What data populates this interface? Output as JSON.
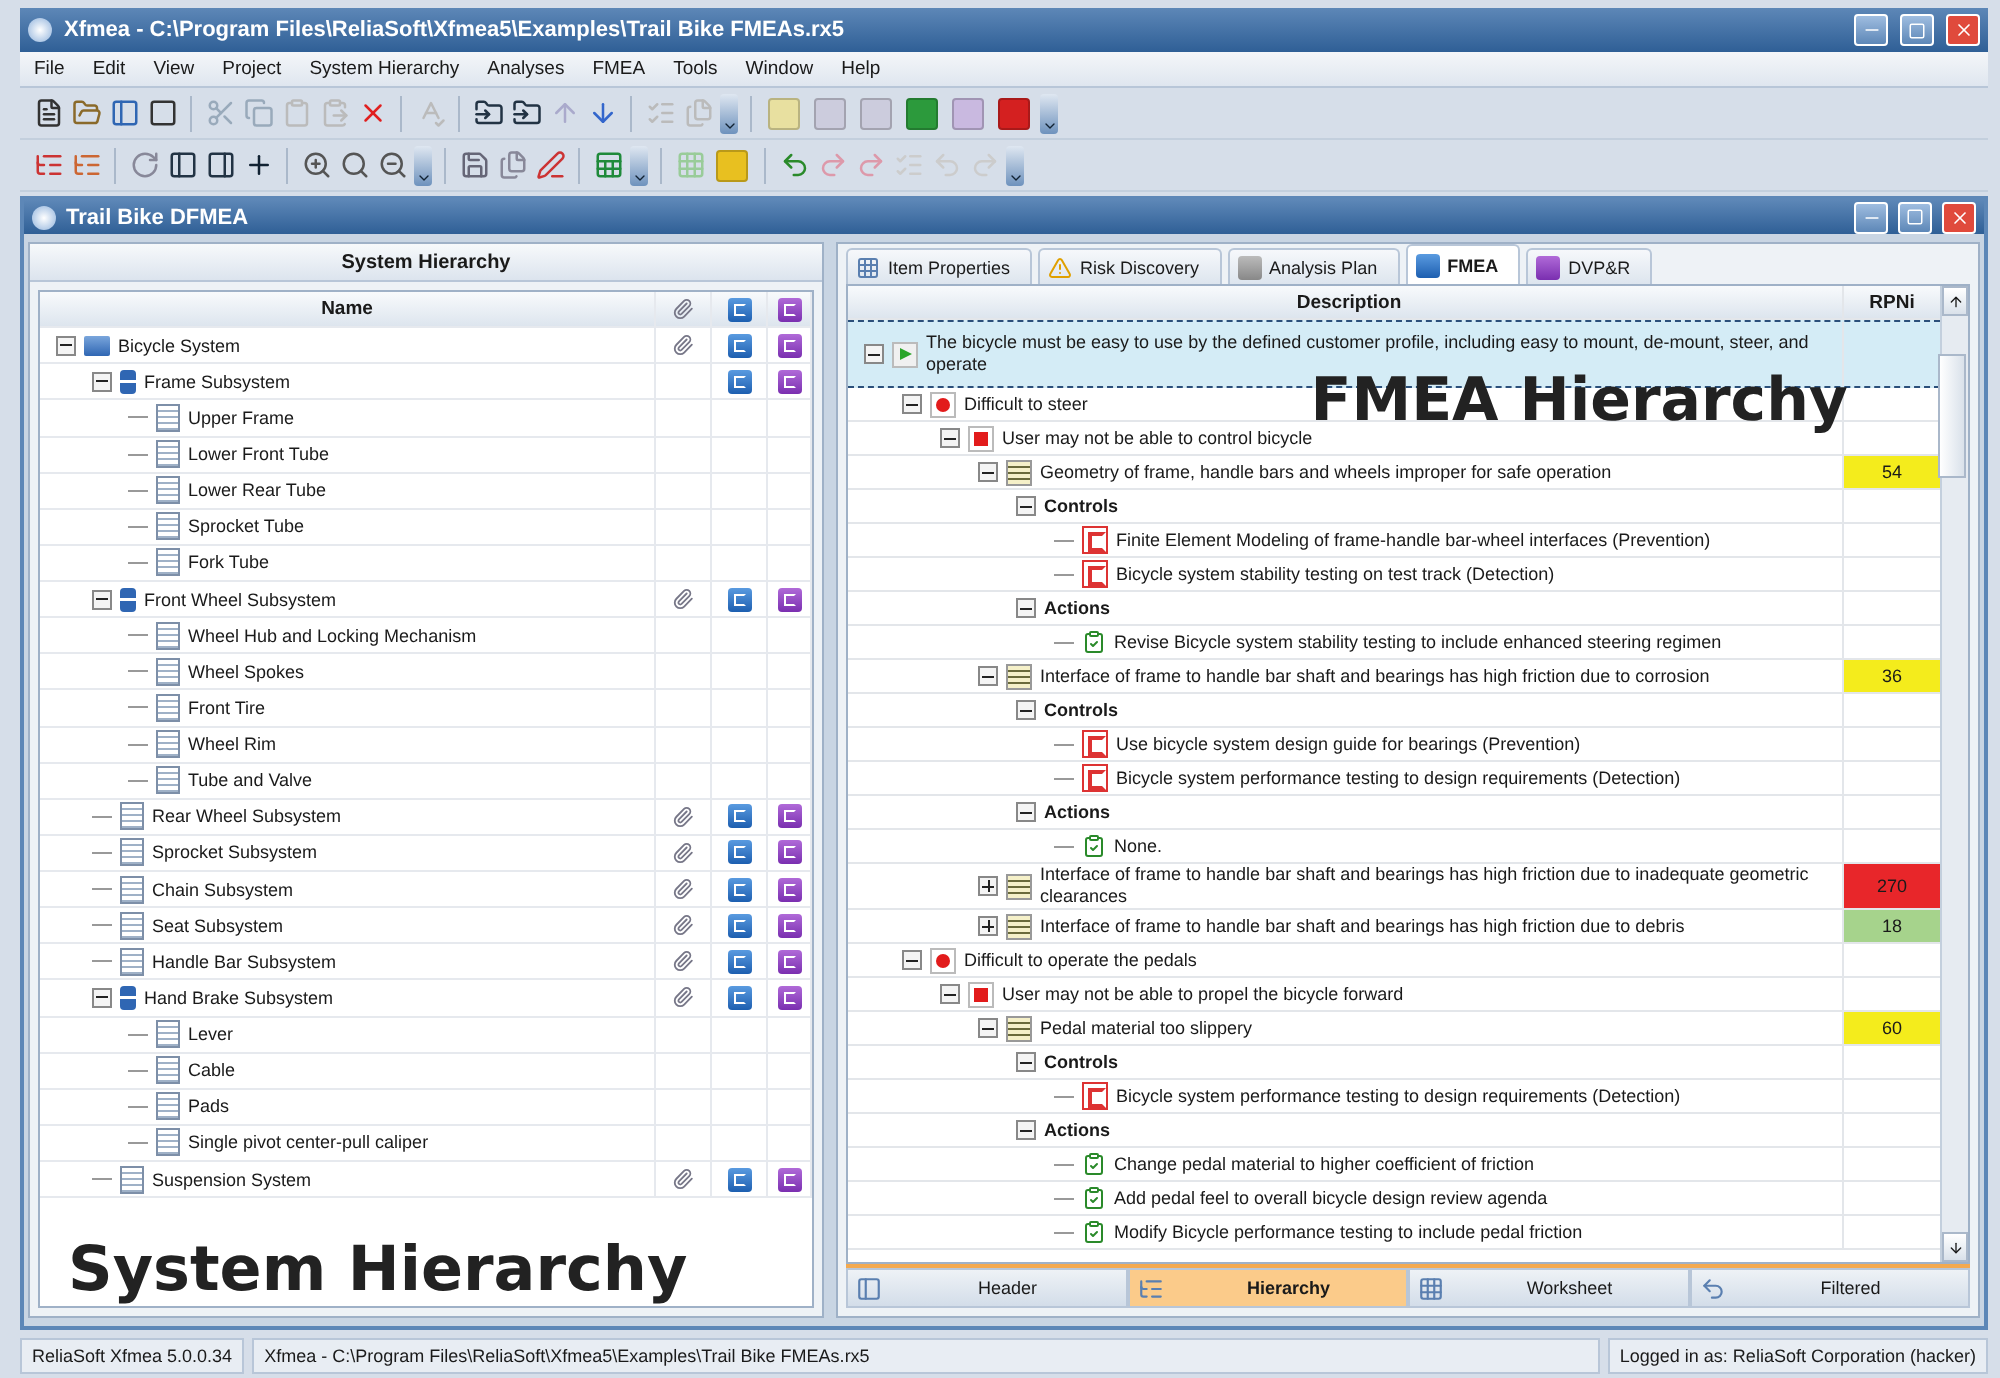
{
  "window": {
    "title": "Xfmea - C:\\Program Files\\ReliaSoft\\Xfmea5\\Examples\\Trail Bike FMEAs.rx5"
  },
  "menu": [
    "File",
    "Edit",
    "View",
    "Project",
    "System Hierarchy",
    "Analyses",
    "FMEA",
    "Tools",
    "Window",
    "Help"
  ],
  "document_window": {
    "title": "Trail Bike DFMEA"
  },
  "system_hierarchy": {
    "title": "System Hierarchy",
    "name_column": "Name",
    "caption": "System Hierarchy",
    "tree": [
      {
        "name": "Bicycle System",
        "kind": "system",
        "attachment": true,
        "fmea": true,
        "dvp": true,
        "expanded": true,
        "children": [
          {
            "name": "Frame Subsystem",
            "kind": "subsystem",
            "attachment": false,
            "fmea": true,
            "dvp": true,
            "expanded": true,
            "children": [
              {
                "name": "Upper Frame",
                "kind": "item",
                "attachment": false,
                "fmea": false,
                "dvp": false
              },
              {
                "name": "Lower Front Tube",
                "kind": "item",
                "attachment": false,
                "fmea": false,
                "dvp": false
              },
              {
                "name": "Lower Rear Tube",
                "kind": "item",
                "attachment": false,
                "fmea": false,
                "dvp": false
              },
              {
                "name": "Sprocket Tube",
                "kind": "item",
                "attachment": false,
                "fmea": false,
                "dvp": false
              },
              {
                "name": "Fork Tube",
                "kind": "item",
                "attachment": false,
                "fmea": false,
                "dvp": false
              }
            ]
          },
          {
            "name": "Front Wheel Subsystem",
            "kind": "subsystem",
            "attachment": true,
            "fmea": true,
            "dvp": true,
            "expanded": true,
            "children": [
              {
                "name": "Wheel Hub and Locking Mechanism",
                "kind": "item",
                "attachment": false,
                "fmea": false,
                "dvp": false
              },
              {
                "name": "Wheel Spokes",
                "kind": "item",
                "attachment": false,
                "fmea": false,
                "dvp": false
              },
              {
                "name": "Front Tire",
                "kind": "item",
                "attachment": false,
                "fmea": false,
                "dvp": false
              },
              {
                "name": "Wheel Rim",
                "kind": "item",
                "attachment": false,
                "fmea": false,
                "dvp": false
              },
              {
                "name": "Tube and Valve",
                "kind": "item",
                "attachment": false,
                "fmea": false,
                "dvp": false
              }
            ]
          },
          {
            "name": "Rear Wheel Subsystem",
            "kind": "item",
            "attachment": true,
            "fmea": true,
            "dvp": true
          },
          {
            "name": "Sprocket Subsystem",
            "kind": "item",
            "attachment": true,
            "fmea": true,
            "dvp": true
          },
          {
            "name": "Chain Subsystem",
            "kind": "item",
            "attachment": true,
            "fmea": true,
            "dvp": true
          },
          {
            "name": "Seat Subsystem",
            "kind": "item",
            "attachment": true,
            "fmea": true,
            "dvp": true
          },
          {
            "name": "Handle Bar Subsystem",
            "kind": "item",
            "attachment": true,
            "fmea": true,
            "dvp": true
          },
          {
            "name": "Hand Brake Subsystem",
            "kind": "subsystem",
            "attachment": true,
            "fmea": true,
            "dvp": true,
            "expanded": true,
            "children": [
              {
                "name": "Lever",
                "kind": "item",
                "attachment": false,
                "fmea": false,
                "dvp": false
              },
              {
                "name": "Cable",
                "kind": "item",
                "attachment": false,
                "fmea": false,
                "dvp": false
              },
              {
                "name": "Pads",
                "kind": "item",
                "attachment": false,
                "fmea": false,
                "dvp": false
              },
              {
                "name": "Single pivot center-pull caliper",
                "kind": "item",
                "attachment": false,
                "fmea": false,
                "dvp": false
              }
            ]
          },
          {
            "name": "Suspension System",
            "kind": "item",
            "attachment": true,
            "fmea": true,
            "dvp": true
          }
        ]
      }
    ]
  },
  "tabs": [
    {
      "label": "Item Properties",
      "selected": false
    },
    {
      "label": "Risk Discovery",
      "selected": false
    },
    {
      "label": "Analysis Plan",
      "selected": false
    },
    {
      "label": "FMEA",
      "selected": true
    },
    {
      "label": "DVP&R",
      "selected": false
    }
  ],
  "fmea": {
    "columns": [
      "Description",
      "RPNi"
    ],
    "caption": "FMEA Hierarchy",
    "rows": [
      {
        "kind": "function",
        "text": "The bicycle must be easy to use by the defined customer profile, including easy to mount, de-mount, steer, and operate",
        "expanded": true,
        "children": [
          {
            "kind": "failure",
            "text": "Difficult to steer",
            "expanded": true,
            "children": [
              {
                "kind": "effect",
                "text": "User may not be able to control bicycle",
                "expanded": true,
                "children": [
                  {
                    "kind": "cause",
                    "text": "Geometry of frame, handle bars and wheels improper for safe operation",
                    "rpn": "54",
                    "color": "#f4ec1c",
                    "expanded": true,
                    "children": [
                      {
                        "kind": "group",
                        "text": "Controls",
                        "expanded": true,
                        "children": [
                          {
                            "kind": "control",
                            "text": "Finite Element Modeling of frame-handle bar-wheel interfaces (Prevention)"
                          },
                          {
                            "kind": "control",
                            "text": "Bicycle system stability testing on test track (Detection)"
                          }
                        ]
                      },
                      {
                        "kind": "group",
                        "text": "Actions",
                        "expanded": true,
                        "children": [
                          {
                            "kind": "action",
                            "text": "Revise Bicycle system stability testing to include enhanced steering regimen"
                          }
                        ]
                      }
                    ]
                  },
                  {
                    "kind": "cause",
                    "text": "Interface of frame to handle bar shaft and bearings has high friction due to corrosion",
                    "rpn": "36",
                    "color": "#f4ec1c",
                    "expanded": true,
                    "children": [
                      {
                        "kind": "group",
                        "text": "Controls",
                        "expanded": true,
                        "children": [
                          {
                            "kind": "control",
                            "text": "Use bicycle system design guide for bearings (Prevention)"
                          },
                          {
                            "kind": "control",
                            "text": "Bicycle system performance testing to design requirements (Detection)"
                          }
                        ]
                      },
                      {
                        "kind": "group",
                        "text": "Actions",
                        "expanded": true,
                        "children": [
                          {
                            "kind": "action",
                            "text": "None."
                          }
                        ]
                      }
                    ]
                  },
                  {
                    "kind": "cause",
                    "text": "Interface of frame to handle bar shaft and bearings has high friction due to inadequate geometric clearances",
                    "rpn": "270",
                    "color": "#e8262a",
                    "expanded": false
                  },
                  {
                    "kind": "cause",
                    "text": "Interface of frame to handle bar shaft and bearings has high friction due to debris",
                    "rpn": "18",
                    "color": "#a6d38c",
                    "expanded": false
                  }
                ]
              }
            ]
          },
          {
            "kind": "failure",
            "text": "Difficult to operate the pedals",
            "expanded": true,
            "children": [
              {
                "kind": "effect",
                "text": "User may not be able to propel the bicycle forward",
                "expanded": true,
                "children": [
                  {
                    "kind": "cause",
                    "text": "Pedal material too slippery",
                    "rpn": "60",
                    "color": "#f4ec1c",
                    "expanded": true,
                    "children": [
                      {
                        "kind": "group",
                        "text": "Controls",
                        "expanded": true,
                        "children": [
                          {
                            "kind": "control",
                            "text": "Bicycle system performance testing to design requirements (Detection)"
                          }
                        ]
                      },
                      {
                        "kind": "group",
                        "text": "Actions",
                        "expanded": true,
                        "children": [
                          {
                            "kind": "action",
                            "text": "Change pedal material to higher coefficient of friction"
                          },
                          {
                            "kind": "action",
                            "text": "Add pedal feel to overall bicycle design review agenda"
                          },
                          {
                            "kind": "action",
                            "text": "Modify Bicycle performance testing to include pedal friction"
                          }
                        ]
                      }
                    ]
                  }
                ]
              }
            ]
          }
        ]
      }
    ]
  },
  "view_tabs": [
    {
      "label": "Header",
      "selected": false
    },
    {
      "label": "Hierarchy",
      "selected": true
    },
    {
      "label": "Worksheet",
      "selected": false
    },
    {
      "label": "Filtered",
      "selected": false
    }
  ],
  "status_bar": [
    "ReliaSoft Xfmea 5.0.0.34",
    "Xfmea - C:\\Program Files\\ReliaSoft\\Xfmea5\\Examples\\Trail Bike FMEAs.rx5",
    "Logged in as: ReliaSoft Corporation (hacker)"
  ]
}
